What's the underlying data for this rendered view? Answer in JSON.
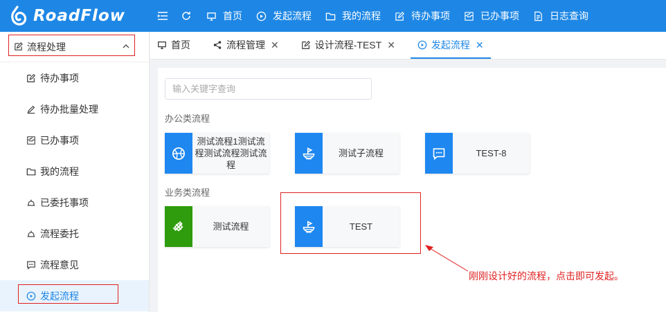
{
  "app": {
    "logo_text": "RoadFlow"
  },
  "topnav": [
    {
      "label": "首页",
      "icon": "monitor-icon"
    },
    {
      "label": "发起流程",
      "icon": "play-circle-icon"
    },
    {
      "label": "我的流程",
      "icon": "folder-icon"
    },
    {
      "label": "待办事项",
      "icon": "edit-icon"
    },
    {
      "label": "已办事项",
      "icon": "inbox-check-icon"
    },
    {
      "label": "日志查询",
      "icon": "document-icon"
    }
  ],
  "sidebar": {
    "group_label": "流程处理",
    "items": [
      {
        "label": "待办事项",
        "icon": "edit-icon"
      },
      {
        "label": "待办批量处理",
        "icon": "pen-icon"
      },
      {
        "label": "已办事项",
        "icon": "inbox-check-icon"
      },
      {
        "label": "我的流程",
        "icon": "folder-icon"
      },
      {
        "label": "已委托事项",
        "icon": "bell-icon"
      },
      {
        "label": "流程委托",
        "icon": "bell-icon"
      },
      {
        "label": "流程意见",
        "icon": "comment-icon"
      },
      {
        "label": "发起流程",
        "icon": "play-circle-icon",
        "active": true
      }
    ]
  },
  "tabs": [
    {
      "label": "首页",
      "icon": "monitor-icon",
      "closable": false
    },
    {
      "label": "流程管理",
      "icon": "share-icon",
      "closable": true
    },
    {
      "label": "设计流程-TEST",
      "icon": "edit-icon",
      "closable": true
    },
    {
      "label": "发起流程",
      "icon": "play-circle-icon",
      "closable": true,
      "active": true
    }
  ],
  "tab_close_glyph": "✕",
  "main": {
    "search_placeholder": "输入关键字查询",
    "categories": [
      {
        "name": "办公类流程",
        "flows": [
          {
            "label": "测试流程1测试流程测试流程测试流程",
            "icon": "basketball-icon",
            "color": "#1e87f0"
          },
          {
            "label": "测试子流程",
            "icon": "bowl-icon",
            "color": "#1e87f0"
          },
          {
            "label": "TEST-8",
            "icon": "comment-icon",
            "color": "#1e87f0"
          }
        ]
      },
      {
        "name": "业务类流程",
        "flows": [
          {
            "label": "测试流程",
            "icon": "candy-icon",
            "color": "#2e9c0c"
          },
          {
            "label": "TEST",
            "icon": "bowl-icon",
            "color": "#1e87f0"
          }
        ]
      }
    ],
    "annotation": "刚刚设计好的流程，点击即可发起。"
  },
  "colors": {
    "brand": "#1e87e5",
    "highlight": "#e02020"
  }
}
